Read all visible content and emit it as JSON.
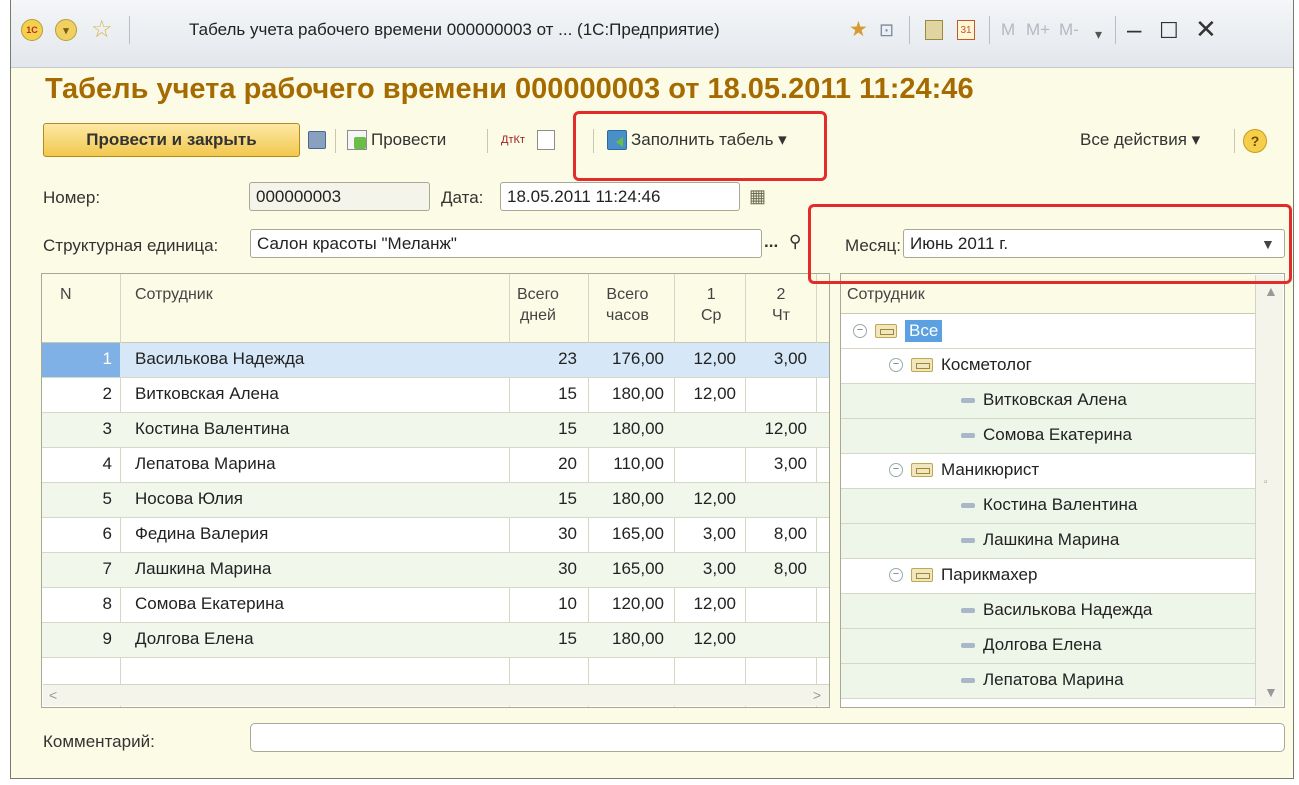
{
  "titlebar": {
    "logo": "1С",
    "title": "Табель учета рабочего времени 000000003 от ... (1С:Предприятие)",
    "m": "M",
    "m_plus": "M+",
    "m_minus": "M-",
    "calendar_day": "31"
  },
  "document_title": "Табель учета рабочего времени 000000003 от 18.05.2011 11:24:46",
  "toolbar": {
    "post_close": "Провести и закрыть",
    "post": "Провести",
    "dt_kt": "ДтКт",
    "fill": "Заполнить табель ▾",
    "all_actions": "Все действия ▾",
    "help": "?"
  },
  "form": {
    "number_label": "Номер:",
    "number_value": "000000003",
    "date_label": "Дата:",
    "date_value": "18.05.2011 11:24:46",
    "unit_label": "Структурная единица:",
    "unit_value": "Салон красоты \"Меланж\"",
    "unit_select": "...",
    "month_label": "Месяц:",
    "month_value": "Июнь 2011 г.",
    "comment_label": "Комментарий:",
    "comment_value": ""
  },
  "table": {
    "headers": {
      "n": "N",
      "employee": "Сотрудник",
      "days_1": "Всего",
      "days_2": "дней",
      "hours_1": "Всего",
      "hours_2": "часов",
      "d1_1": "1",
      "d1_2": "Ср",
      "d2_1": "2",
      "d2_2": "Чт"
    },
    "rows": [
      {
        "n": "1",
        "name": "Василькова Надежда",
        "days": "23",
        "hours": "176,00",
        "d1": "12,00",
        "d2": "3,00"
      },
      {
        "n": "2",
        "name": "Витковская Алена",
        "days": "15",
        "hours": "180,00",
        "d1": "12,00",
        "d2": ""
      },
      {
        "n": "3",
        "name": "Костина Валентина",
        "days": "15",
        "hours": "180,00",
        "d1": "",
        "d2": "12,00"
      },
      {
        "n": "4",
        "name": "Лепатова Марина",
        "days": "20",
        "hours": "110,00",
        "d1": "",
        "d2": "3,00"
      },
      {
        "n": "5",
        "name": "Носова Юлия",
        "days": "15",
        "hours": "180,00",
        "d1": "12,00",
        "d2": ""
      },
      {
        "n": "6",
        "name": "Федина Валерия",
        "days": "30",
        "hours": "165,00",
        "d1": "3,00",
        "d2": "8,00"
      },
      {
        "n": "7",
        "name": "Лашкина Марина",
        "days": "30",
        "hours": "165,00",
        "d1": "3,00",
        "d2": "8,00"
      },
      {
        "n": "8",
        "name": "Сомова Екатерина",
        "days": "10",
        "hours": "120,00",
        "d1": "12,00",
        "d2": ""
      },
      {
        "n": "9",
        "name": "Долгова Елена",
        "days": "15",
        "hours": "180,00",
        "d1": "12,00",
        "d2": ""
      }
    ]
  },
  "tree": {
    "header": "Сотрудник",
    "root": "Все",
    "groups": [
      {
        "name": "Косметолог",
        "items": [
          "Витковская Алена",
          "Сомова Екатерина"
        ]
      },
      {
        "name": "Маникюрист",
        "items": [
          "Костина Валентина",
          "Лашкина Марина"
        ]
      },
      {
        "name": "Парикмахер",
        "items": [
          "Василькова Надежда",
          "Долгова Елена",
          "Лепатова Марина"
        ]
      }
    ]
  },
  "colors": {
    "title_color": "#a56a00",
    "highlight_red": "#e32b2b",
    "selection": "#7fb1e6",
    "background": "#fbfbe6"
  }
}
